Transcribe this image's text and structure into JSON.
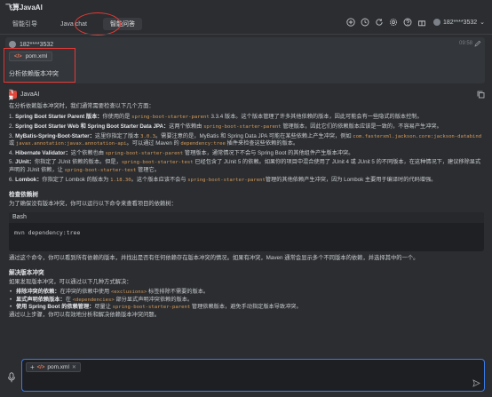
{
  "app": {
    "title": "飞算JavaAI"
  },
  "tabs": [
    {
      "label": "智能引导"
    },
    {
      "label": "Java chat"
    },
    {
      "label": "智能问答"
    }
  ],
  "toolbar": {
    "icons": [
      "add-icon",
      "history-icon",
      "refresh-icon",
      "settings-icon",
      "help-icon",
      "gift-icon"
    ],
    "user": "182****3532"
  },
  "user_message": {
    "name": "182****3532",
    "time": "09:58",
    "file": "pom.xml",
    "prompt": "分析依赖版本冲突"
  },
  "assistant": {
    "name": "JavaAI",
    "logo": "飞算",
    "intro": "在分析依赖版本冲突时，我们通常需要检查以下几个方面：",
    "items": [
      {
        "num": "1.",
        "title": "Spring Boot Starter Parent 版本：",
        "text": "你使用的是 ",
        "code": "spring-boot-starter-parent",
        "text2": " 3.3.4 版本。这个版本管理了许多其他依赖的版本，因此可能会有一些隐式的版本控制。"
      },
      {
        "num": "2.",
        "title": "Spring Boot Starter Web 和 Spring Boot Starter Data JPA：",
        "text": "这两个依赖由 ",
        "code": "spring-boot-starter-parent",
        "text2": " 管理版本，因此它们的依赖版本应该是一致的，不容易产生冲突。"
      },
      {
        "num": "3.",
        "title": "MyBatis-Spring-Boot-Starter：",
        "text": "这里你指定了版本 ",
        "code": "3.0.3",
        "text2": "。需要注意的是，MyBatis 和 Spring Data JPA 可能在某些依赖上产生冲突，例如 ",
        "code2": "com.fasterxml.jackson.core:jackson-databind",
        "text3": " 或 ",
        "code3": "javax.annotation:javax.annotation-api",
        "text4": "。可以通过 Maven 的 ",
        "code4": "dependency:tree",
        "text5": " 插件来检查这些依赖的版本。"
      },
      {
        "num": "4.",
        "title": "Hibernate Validator：",
        "text": "这个依赖也由 ",
        "code": "spring-boot-starter-parent",
        "text2": " 管理版本，通常情况下不会与 Spring Boot 的其他组件产生版本冲突。"
      },
      {
        "num": "5.",
        "title": "JUnit：",
        "text": "你指定了 JUnit 依赖的版本。但是，",
        "code": "spring-boot-starter-test",
        "text2": " 已经包含了 JUnit 5 的依赖。如果你的项目中混合使用了 JUnit 4 或 JUnit 5 的不同版本，在这种情况下，建议移除显式声明的 JUnit 依赖，让 ",
        "code2": "spring-boot-starter-test",
        "text3": " 管理它。"
      },
      {
        "num": "6.",
        "title": "Lombok：",
        "text": "你指定了 Lombok 的版本为 ",
        "code": "1.18.30",
        "text2": "。这个版本应该不会与 ",
        "code2": "spring-boot-starter-parent",
        "text3": "管理的其他依赖产生冲突，因为 Lombok 主要用于编译时的代码增强。"
      }
    ],
    "check_heading": "检查依赖树",
    "check_text": "为了确保没有版本冲突，你可以运行以下命令来查看项目的依赖树：",
    "code_lang": "Bash",
    "code_line": "mvn dependency:tree",
    "after_code": "通过这个命令，你可以看到所有依赖的版本，并找出是否有任何依赖存在版本冲突的情况。如果有冲突，Maven 通常会显示多个不同版本的依赖，并选择其中的一个。",
    "resolve_heading": "解决版本冲突",
    "resolve_text": "如果发现版本冲突，可以通过以下几种方式解决：",
    "resolve_items": [
      {
        "title": "排除冲突的依赖：",
        "text": "在冲突的依赖中使用 ",
        "code": "<exclusions>",
        "text2": " 标签排除不需要的版本。"
      },
      {
        "title": "显式声明依赖版本：",
        "text": "在 ",
        "code": "<dependencies>",
        "text2": " 部分显式声明冲突依赖的版本。"
      },
      {
        "title": "使用 Spring Boot 的依赖管理：",
        "text": "尽量让 ",
        "code": "spring-boot-starter-parent",
        "text2": " 管理依赖版本，避免手动指定版本导致冲突。"
      }
    ],
    "cutoff": "通过以上步骤，你可以有效地分析和解决依赖版本冲突问题。"
  },
  "input": {
    "file": "pom.xml",
    "placeholder": ""
  },
  "colors": {
    "accent": "#3c7ae6",
    "highlight": "#e53935",
    "code": "#d49a5a"
  }
}
